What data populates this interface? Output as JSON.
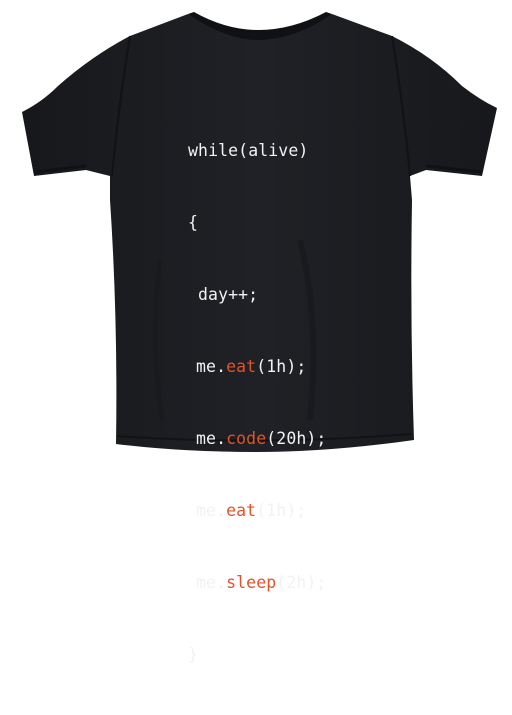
{
  "colors": {
    "shirt": "#1c1d21",
    "shirt_shadow": "#141518",
    "code_text": "#f2f2f2",
    "accent": "#e0542a"
  },
  "code": {
    "line1": "while(alive)",
    "line2": "{",
    "line3": "day++;",
    "line4": {
      "prefix": "me.",
      "method": "eat",
      "suffix": "(1h);"
    },
    "line5": {
      "prefix": "me.",
      "method": "code",
      "suffix": "(20h);"
    },
    "line6": {
      "prefix": "me.",
      "method": "eat",
      "suffix": "(1h);"
    },
    "line7": {
      "prefix": "me.",
      "method": "sleep",
      "suffix": "(2h);"
    },
    "line8": "}"
  }
}
